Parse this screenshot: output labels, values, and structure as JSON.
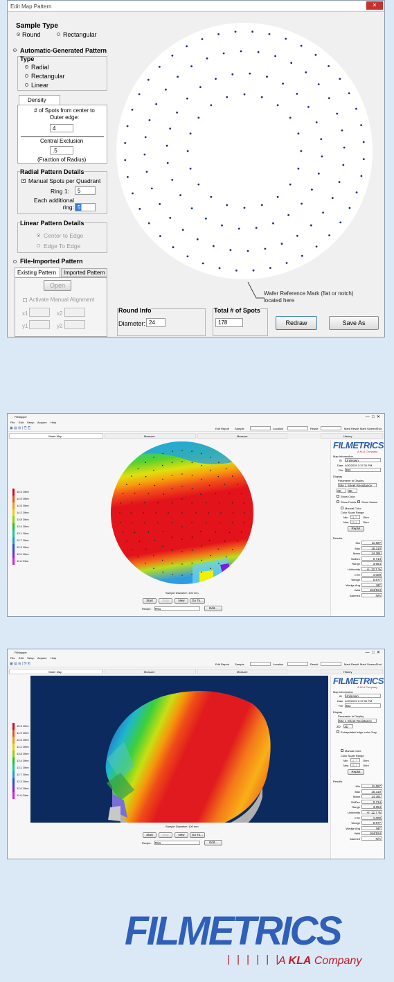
{
  "edit_dialog": {
    "title": "Edit Map Pattern",
    "sample_type": {
      "heading": "Sample Type",
      "round": "Round",
      "rectangular": "Rectangular"
    },
    "auto_pattern": {
      "heading": "Automatic-Generated Pattern",
      "type_heading": "Type",
      "radial": "Radial",
      "rectangular": "Rectangular",
      "linear": "Linear"
    },
    "density": {
      "tab": "Density",
      "spots_label": "# of Spots from center to Outer edge:",
      "spots_value": "4",
      "central_exclusion_label": "Central Exclusion",
      "central_exclusion_value": ".5",
      "fraction_label": "(Fraction of Radius)"
    },
    "radial_details": {
      "heading": "Radial Pattern Details",
      "manual_label": "Manual Spots per Quadrant",
      "ring1_label": "Ring 1:",
      "ring1_value": "5",
      "each_additional_label": "Each additional ring:",
      "each_additional_value": "5"
    },
    "linear_details": {
      "heading": "Linear Pattern Details",
      "center_to_edge": "Center to Edge",
      "edge_to_edge": "Edge To Edge"
    },
    "file_pattern": {
      "heading": "File-Imported Pattern",
      "tab_existing": "Existing Pattern",
      "tab_imported": "Imported Pattern",
      "open": "Open",
      "activate_manual": "Activate Manual Alignment",
      "x1": "x1",
      "x2": "x2",
      "y1": "y1",
      "y2": "y2"
    },
    "round_info": {
      "heading": "Round Info",
      "diameter_label": "Diameter:",
      "diameter_value": "24"
    },
    "total_spots": {
      "heading": "Total # of Spots",
      "value": "178"
    },
    "redraw": "Redraw",
    "save_as": "Save As",
    "wafer_note": "Wafer Reference Mark (flat or notch) located here"
  },
  "app": {
    "title": "FilMapper",
    "menu": [
      "File",
      "Edit",
      "Setup",
      "Acquire",
      "Help"
    ],
    "toolbar": {
      "edit_report": "Edit Report",
      "sample": "Sample",
      "location": "Location",
      "result": "Result",
      "mark_result": "Mark Result",
      "mark_screenshot": "Mark ScreenShot"
    },
    "tabs": [
      "Wafer Map",
      "Measure",
      "Measure",
      "History"
    ],
    "logo": "FILMETRICS",
    "logo_sub": "A KLA Company",
    "map_info": {
      "heading": "Map Information",
      "id_label": "ID",
      "id_value": "Unknown",
      "date_label": "Date",
      "date_value": "4/20/2020 2:37:31 PM",
      "file_label": "File",
      "file_value": "352"
    },
    "display": {
      "heading": "Display",
      "param_label": "Parameter to Display",
      "param_value": "Site 1 Sheet Resistance",
      "view_2d": "2D",
      "view_3d": "3D",
      "show_color": "Show Color",
      "show_points": "Show Points",
      "show_values": "Show Values",
      "manual_color": "Manual Color",
      "color_range": "Color Scale Range",
      "min_label": "Min",
      "min_value": "11.7",
      "max_label": "Max",
      "max_value": "15.3",
      "unit": "Ohm",
      "replot": "Replot",
      "extrapolated": "Extrapolated edge color Gray"
    },
    "results": {
      "heading": "Results",
      "rows": [
        {
          "label": "Min",
          "value": "11.657"
        },
        {
          "label": "Max",
          "value": "15.310"
        },
        {
          "label": "Mean",
          "value": "14.391"
        },
        {
          "label": "StdDev",
          "value": "0.714"
        },
        {
          "label": "Range",
          "value": "3.654"
        },
        {
          "label": "Uniformity",
          "value": "+/- 12.7 %"
        },
        {
          "label": "CTE",
          "value": "1.000"
        },
        {
          "label": "Wedge",
          "value": "0.877"
        },
        {
          "label": "Wedge Ang",
          "value": "99°"
        },
        {
          "label": "Valid",
          "value": "164/164"
        },
        {
          "label": "Alarmed",
          "value": "N/A"
        }
      ]
    },
    "legend": [
      "15.3 Ohm",
      "14.9 Ohm",
      "14.5 Ohm",
      "14.2 Ohm",
      "13.8 Ohm",
      "13.4 Ohm",
      "13.1 Ohm",
      "12.7 Ohm",
      "12.3 Ohm",
      "12.0 Ohm",
      "11.6 Ohm"
    ],
    "legend_colors": [
      "#e0001a",
      "#f24a12",
      "#f59a0a",
      "#e6d400",
      "#8bd400",
      "#1fc21c",
      "#13c7a0",
      "#159ad8",
      "#1f4be0",
      "#7a1fe6",
      "#d31fe0"
    ],
    "sample_diameter": "Sample Diameter: 100 mm",
    "start": "Start",
    "stop": "Stop",
    "new": "New",
    "goto": "Go To...",
    "recipe_label": "Recipe:",
    "recipe_value": "R51",
    "edit": "Edit..."
  },
  "footer_logo": {
    "name": "FILMETRICS",
    "tagline_prefix": "A",
    "tagline_brand": "KLA",
    "tagline_suffix": "Company"
  }
}
